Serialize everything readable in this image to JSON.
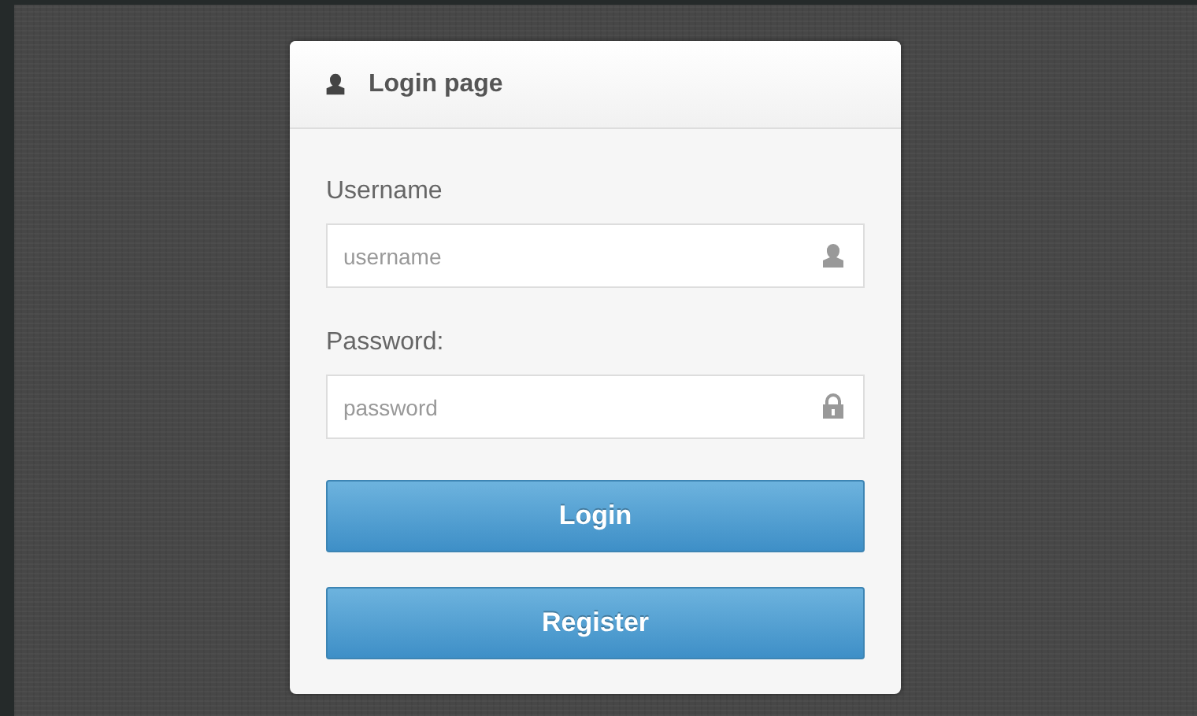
{
  "panel": {
    "title": "Login page",
    "fields": [
      {
        "label": "Username",
        "placeholder": "username",
        "kind": "user"
      },
      {
        "label": "Password:",
        "placeholder": "password",
        "kind": "lock"
      }
    ],
    "buttons": [
      "Login",
      "Register"
    ]
  }
}
